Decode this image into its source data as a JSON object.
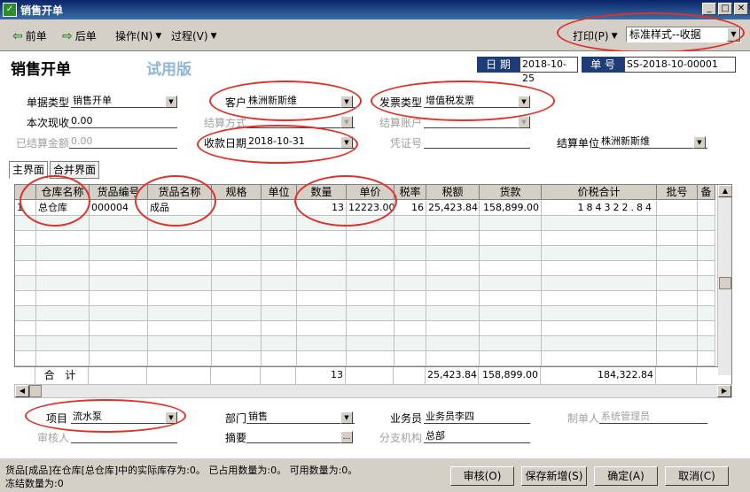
{
  "window": {
    "title": "销售开单"
  },
  "toolbar": {
    "prev_label": "前单",
    "next_label": "后单",
    "operate_label": "操作(N)",
    "process_label": "过程(V)",
    "print_label": "打印(P)",
    "print_style": "标准样式--收据"
  },
  "header": {
    "page_title": "销售开单",
    "trial_badge": "试用版",
    "date_label": "日 期",
    "date_value": "2018-10-25",
    "no_label": "单 号",
    "no_value": "SS-2018-10-00001"
  },
  "form": {
    "doc_type_label": "单据类型",
    "doc_type_value": "销售开单",
    "customer_label": "客户",
    "customer_value": "株洲新斯维",
    "invoice_type_label": "发票类型",
    "invoice_type_value": "增值税发票",
    "cash_label": "本次现收",
    "cash_value": "0.00",
    "settle_method_label": "结算方式",
    "settle_account_label": "结算账户",
    "settled_amount_label": "已结算金额",
    "settled_amount_value": "0.00",
    "receive_date_label": "收款日期",
    "receive_date_value": "2018-10-31",
    "voucher_label": "凭证号",
    "settle_unit_label": "结算单位",
    "settle_unit_value": "株洲新斯维"
  },
  "tabs": [
    {
      "label": "主界面"
    },
    {
      "label": "合并界面"
    }
  ],
  "table": {
    "headers": [
      "仓库名称",
      "货品编号",
      "货品名称",
      "规格",
      "单位",
      "数量",
      "单价",
      "税率",
      "税额",
      "货款",
      "价税合计",
      "批号",
      "备"
    ],
    "rows": [
      {
        "index": "1",
        "warehouse": "总仓库",
        "code": "000004",
        "name": "成品",
        "spec": "",
        "unit": "",
        "qty": "13",
        "price": "12223.00",
        "tax_rate": "16",
        "tax": "25,423.84",
        "amount": "158,899.00",
        "total": "184322.84",
        "batch": ""
      }
    ],
    "total_row": {
      "label": "合 计",
      "qty": "13",
      "tax": "25,423.84",
      "amount": "158,899.00",
      "total": "184,322.84"
    }
  },
  "footer": {
    "project_label": "项目",
    "project_value": "流水泵",
    "dept_label": "部门",
    "dept_value": "销售",
    "salesman_label": "业务员",
    "salesman_value": "业务员李四",
    "maker_label": "制单人",
    "maker_value": "系统管理员",
    "auditor_label": "审核人",
    "summary_label": "摘要",
    "branch_label": "分支机构",
    "branch_value": "总部"
  },
  "status": {
    "line1": "货品[成品]在仓库[总仓库]中的实际库存为:0。   已占用数量为:0。  可用数量为:0。",
    "line2": "冻结数量为:0"
  },
  "buttons": {
    "audit": "审核(O)",
    "save_new": "保存新增(S)",
    "ok": "确定(A)",
    "cancel": "取消(C)"
  },
  "colors": {
    "annotation": "#e0302a",
    "header_label_bg": "#1f3c78",
    "trial_text": "#8fb6d8"
  }
}
